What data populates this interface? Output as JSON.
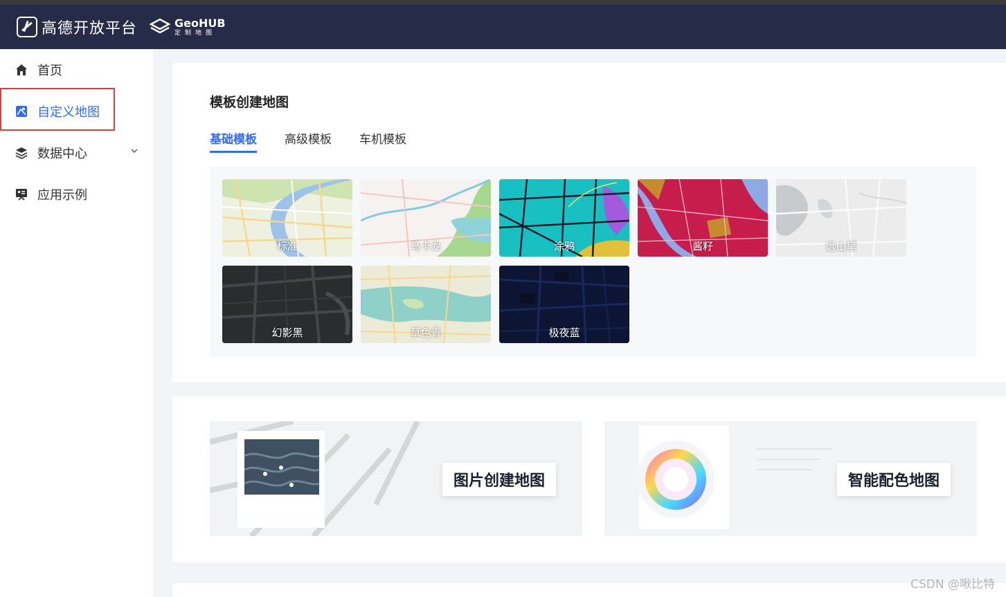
{
  "header": {
    "brand": "高德开放平台",
    "geo_name": "GeoHUB",
    "geo_sub": "定制地图",
    "bg_color": "#262b47"
  },
  "sidebar": {
    "items": [
      {
        "label": "首页",
        "icon": "home-icon"
      },
      {
        "label": "自定义地图",
        "icon": "custom-map-icon",
        "active": true
      },
      {
        "label": "数据中心",
        "icon": "layers-icon",
        "expandable": true
      },
      {
        "label": "应用示例",
        "icon": "showcase-icon"
      }
    ],
    "active_color": "#2f6bff"
  },
  "templates": {
    "title": "模板创建地图",
    "tabs": [
      "基础模板",
      "高级模板",
      "车机模板"
    ],
    "items": [
      {
        "label": "标准",
        "theme": "standard"
      },
      {
        "label": "马卡龙",
        "theme": "macaron"
      },
      {
        "label": "涂鸦",
        "theme": "graffiti"
      },
      {
        "label": "酱籽",
        "theme": "sauce"
      },
      {
        "label": "远山黛",
        "theme": "mountain"
      },
      {
        "label": "幻影黑",
        "theme": "phantom-dark"
      },
      {
        "label": "草色青",
        "theme": "grass-green"
      },
      {
        "label": "极夜蓝",
        "theme": "polar-blue"
      }
    ]
  },
  "creators": {
    "image_map": "图片创建地图",
    "smart_color": "智能配色地图"
  },
  "watermark": "CSDN @啾比特"
}
